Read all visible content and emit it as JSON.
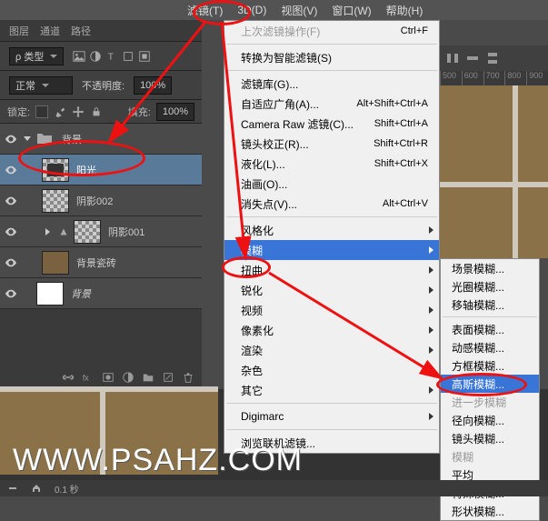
{
  "menubar": {
    "filter": "滤镜(T)",
    "threeD": "3D(D)",
    "view": "视图(V)",
    "window": "窗口(W)",
    "help": "帮助(H)"
  },
  "tabs": {
    "layers": "图层",
    "channels": "通道",
    "paths": "路径"
  },
  "optrow": {
    "kind": "ρ 类型",
    "normal": "正常",
    "opacityLabel": "不透明度:",
    "opacityVal": "100%"
  },
  "lockrow": {
    "lock": "锁定:",
    "fillLabel": "填充:",
    "fillVal": "100%"
  },
  "layers": {
    "folder": "背景",
    "l1": "阳光",
    "l2": "阴影002",
    "l3": "阴影001",
    "l4": "背景瓷砖",
    "l5": "背景"
  },
  "ruler": {
    "r1": "500",
    "r2": "600",
    "r3": "700",
    "r4": "800",
    "r5": "900"
  },
  "dropdown": {
    "lastOp": "上次滤镜操作(F)",
    "lastKey": "Ctrl+F",
    "smart": "转换为智能滤镜(S)",
    "gallery": "滤镜库(G)...",
    "adaptive": "自适应广角(A)...",
    "adaptiveKey": "Alt+Shift+Ctrl+A",
    "cameraraw": "Camera Raw 滤镜(C)...",
    "camerarawKey": "Shift+Ctrl+A",
    "lens": "镜头校正(R)...",
    "lensKey": "Shift+Ctrl+R",
    "liquify": "液化(L)...",
    "liquifyKey": "Shift+Ctrl+X",
    "oil": "油画(O)...",
    "vanish": "消失点(V)...",
    "vanishKey": "Alt+Ctrl+V",
    "stylize": "风格化",
    "blur": "模糊",
    "distort": "扭曲",
    "sharpen": "锐化",
    "video": "视频",
    "pixelate": "像素化",
    "render": "渲染",
    "noise": "杂色",
    "other": "其它",
    "digimarc": "Digimarc",
    "browse": "浏览联机滤镜..."
  },
  "submenu": {
    "field": "场景模糊...",
    "iris": "光圈模糊...",
    "tilt": "移轴模糊...",
    "surface": "表面模糊...",
    "motion": "动感模糊...",
    "box": "方框模糊...",
    "gaussian": "高斯模糊...",
    "more": "进一步模糊",
    "radial": "径向模糊...",
    "lensblur": "镜头模糊...",
    "mohu": "模糊",
    "avg": "平均",
    "special": "特殊模糊...",
    "shape": "形状模糊..."
  },
  "statusbar": {
    "time": "0.1 秒"
  },
  "watermark": "WWW.PSAHZ.COM"
}
